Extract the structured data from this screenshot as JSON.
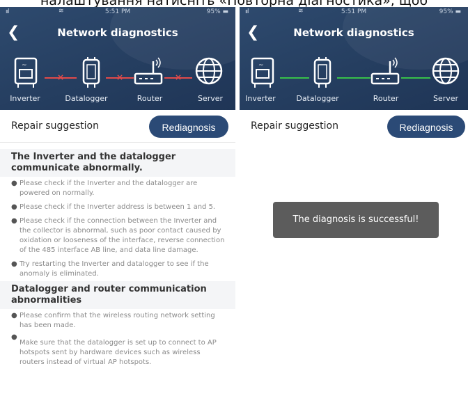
{
  "caption": "налаштування натисніть «Повторна діагностика», щоб",
  "status": {
    "signal": "ııl",
    "wifi": "≋",
    "time": "5:51 PM",
    "battery": "95% ▬"
  },
  "screens": [
    {
      "back_icon": "chevron-left-icon",
      "title": "Network diagnostics",
      "devices": [
        "Inverter",
        "Datalogger",
        "Router",
        "Server"
      ],
      "link_state": "error",
      "link_color": "#e24a4a",
      "repair_label": "Repair suggestion",
      "rediagnosis_label": "Rediagnosis",
      "sections": [
        {
          "heading": "The Inverter and the datalogger communicate abnormally.",
          "items": [
            "Please check if the Inverter and the datalogger are powered on normally.",
            "Please check if the Inverter address is between 1 and 5.",
            "Please check if the connection between the Inverter and the collector is abnormal, such as poor contact caused by oxidation or looseness of the interface, reverse connection of the 485 interface AB line, and data line damage.",
            "Try restarting the Inverter and datalogger to see if the anomaly is eliminated."
          ]
        },
        {
          "heading": "Datalogger and router communication abnormalities",
          "items": [
            "Please confirm that the wireless routing network setting has been made.",
            "Make sure that the datalogger is set up to connect to AP hotspots sent by hardware devices such as wireless routers instead of virtual AP hotspots."
          ]
        }
      ]
    },
    {
      "back_icon": "chevron-left-icon",
      "title": "Network diagnostics",
      "devices": [
        "Inverter",
        "Datalogger",
        "Router",
        "Server"
      ],
      "link_state": "ok",
      "link_color": "#38c14a",
      "repair_label": "Repair suggestion",
      "rediagnosis_label": "Rediagnosis",
      "toast": "The diagnosis is successful!"
    }
  ],
  "colors": {
    "header": "#253e60",
    "button": "#2b4a76",
    "error": "#e24a4a",
    "ok": "#38c14a",
    "toast": "#5c5c5c"
  }
}
